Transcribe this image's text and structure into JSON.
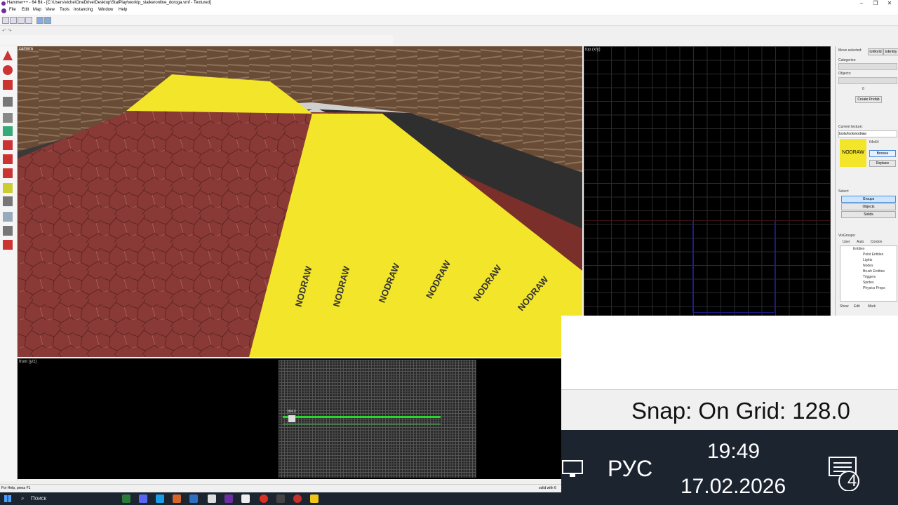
{
  "window": {
    "title": "Hammer++ - 64 Bit - [C:\\Users\\viche\\OneDrive\\Desktop\\StalPlay\\work\\p_stalkeronline_doroga.vmf - Textured]"
  },
  "menu": [
    "File",
    "Edit",
    "Map",
    "View",
    "Tools",
    "Instancing",
    "Window",
    "Help"
  ],
  "viewports": {
    "camera_label": "camera",
    "top_label": "top (x/y)",
    "front_label": "front (y/z)",
    "texture_stamp": "NODRAW"
  },
  "right_panel": {
    "move_selected": "Move selected:",
    "to_world": "toWorld",
    "to_entity": "toEntity",
    "categories_label": "Categories:",
    "objects_label": "Objects:",
    "face_value": "0",
    "create_prefab": "Create Prefab",
    "current_texture_label": "Current texture:",
    "current_texture": "tools/toolsnodraw",
    "texture_preview_text": "NODRAW",
    "texture_size": "64x64",
    "browse": "Browse",
    "replace": "Replace",
    "select_label": "Select:",
    "select_options": [
      "Groups",
      "Objects",
      "Solids"
    ],
    "visgroups_label": "VisGroups:",
    "visgroup_tabs": [
      "User",
      "Auto",
      "Cordon"
    ],
    "visgroup_tree": [
      "Entities",
      "Point Entities",
      "Lights",
      "Nodes",
      "Brush Entities",
      "Triggers",
      "Sprites",
      "Physics Props"
    ],
    "bottom_buttons": [
      "Show",
      "Edit",
      "Mark"
    ]
  },
  "front_view_marker": "384.0",
  "status": {
    "help": "For Help, press F1",
    "right": "solid with 6"
  },
  "snap_text": "Snap: On Grid: 128.0",
  "system_tray": {
    "language": "РУС",
    "time": "19:49",
    "date": "17.02.2026",
    "notifications": "4"
  },
  "taskbar": {
    "search": "Поиск"
  },
  "colors": {
    "nodraw_yellow": "#f3e52a",
    "accent_purple": "#6b2fa0",
    "selection_green": "#2bd62b"
  }
}
